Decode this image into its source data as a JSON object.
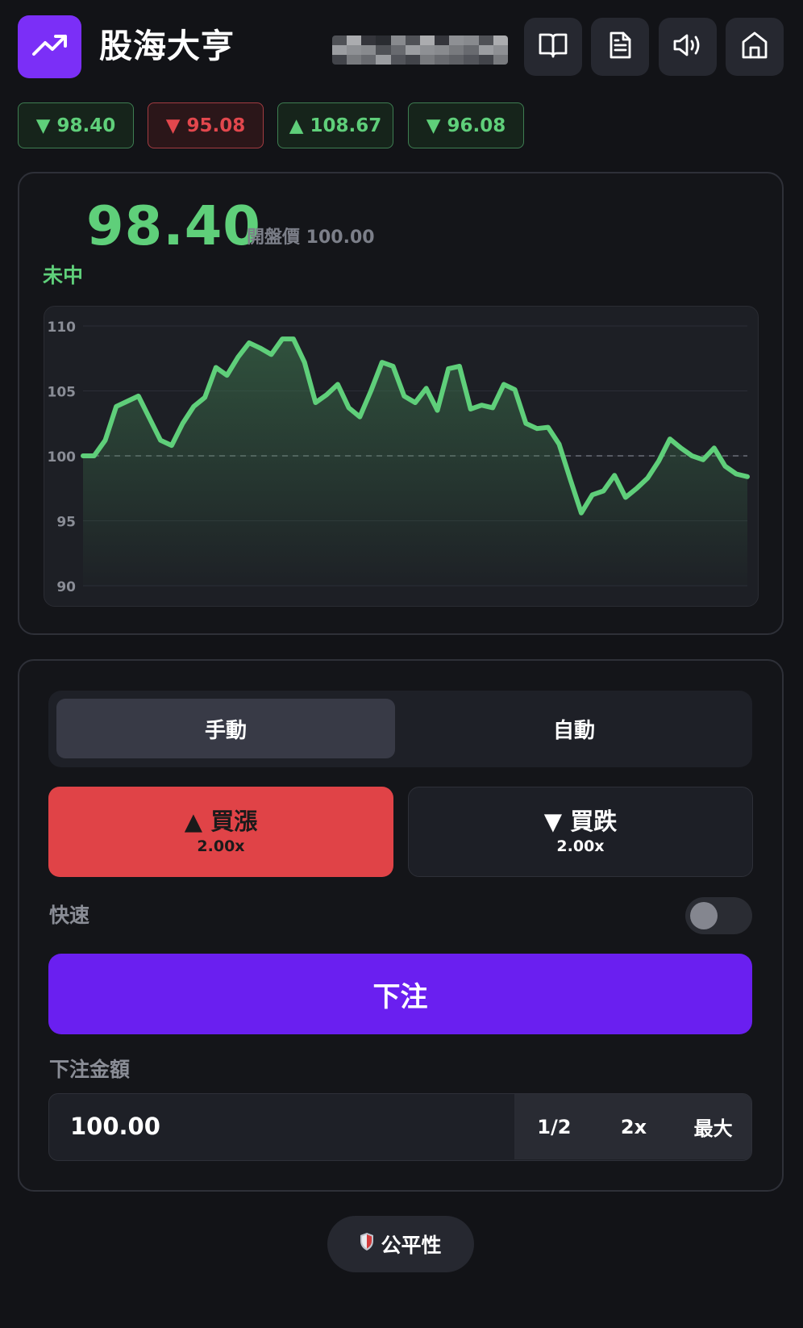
{
  "header": {
    "logo_icon": "trending-up-icon",
    "title": "股海大亨",
    "buttons": [
      {
        "icon": "book-icon"
      },
      {
        "icon": "document-icon"
      },
      {
        "icon": "volume-icon"
      },
      {
        "icon": "home-icon"
      }
    ]
  },
  "history": [
    {
      "label": "▼ 98.40",
      "color": "#5fcf7a"
    },
    {
      "label": "▼ 95.08",
      "color": "#e2474d"
    },
    {
      "label": "▲ 108.67",
      "color": "#5fcf7a"
    },
    {
      "label": "▼ 96.08",
      "color": "#5fcf7a"
    }
  ],
  "round": {
    "price": "98.40",
    "open_label": "開盤價 100.00",
    "status": "未中"
  },
  "chart_data": {
    "type": "area",
    "ylim": [
      90,
      110
    ],
    "y_ticks": [
      "110",
      "105",
      "100",
      "95",
      "90"
    ],
    "baseline": 100,
    "line_color": "#5fcf7a",
    "values": [
      100.0,
      100.0,
      101.2,
      103.8,
      104.2,
      104.6,
      102.9,
      101.2,
      100.8,
      102.5,
      103.8,
      104.5,
      106.8,
      106.2,
      107.6,
      108.7,
      108.3,
      107.8,
      109.0,
      109.0,
      107.2,
      104.1,
      104.7,
      105.5,
      103.7,
      103.0,
      105.0,
      107.2,
      106.9,
      104.6,
      104.1,
      105.2,
      103.5,
      106.7,
      106.9,
      103.6,
      103.9,
      103.7,
      105.5,
      105.1,
      102.5,
      102.1,
      102.2,
      100.9,
      98.2,
      95.6,
      97.0,
      97.3,
      98.5,
      96.8,
      97.5,
      98.3,
      99.6,
      101.3,
      100.6,
      100.0,
      99.7,
      100.6,
      99.2,
      98.6,
      98.4
    ]
  },
  "controls": {
    "tabs": [
      "手動",
      "自動"
    ],
    "bet_up": {
      "label": "▲ 買漲",
      "multiplier": "2.00x"
    },
    "bet_down": {
      "label": "▼ 買跌",
      "multiplier": "2.00x"
    },
    "fast_label": "快速",
    "fast_enabled": false,
    "place_bet": "下注",
    "amount_label": "下注金額",
    "amount_value": "100.00",
    "amount_buttons": [
      "1/2",
      "2x",
      "最大"
    ]
  },
  "fairness": {
    "label": "公平性",
    "icon": "shield-icon"
  }
}
